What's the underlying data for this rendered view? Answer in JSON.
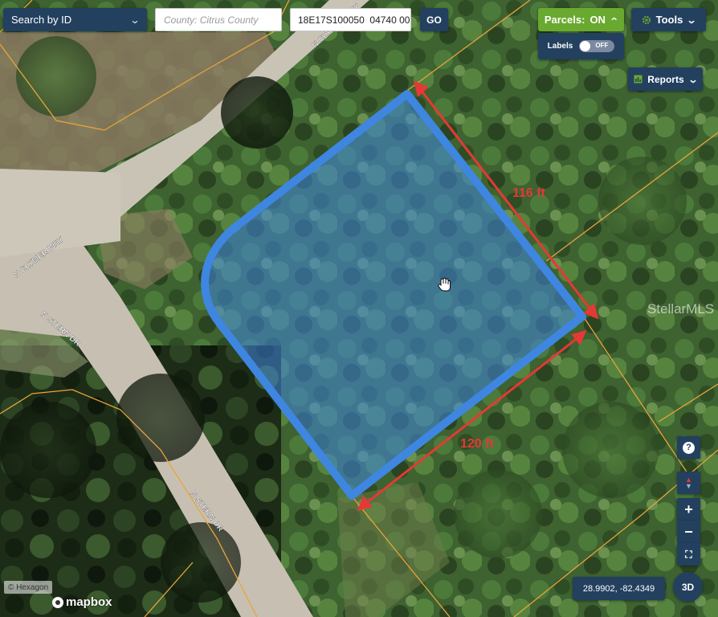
{
  "toolbar": {
    "search_mode": "Search by ID",
    "county_placeholder": "County: Citrus County",
    "parcel_id_value": "18E17S100050  04740 00",
    "go_label": "GO",
    "parcels_label": "Parcels:",
    "parcels_state": "ON",
    "labels_label": "Labels",
    "labels_state": "OFF",
    "tools_label": "Tools",
    "reports_label": "Reports"
  },
  "map": {
    "streets": [
      "N CLYMER WAY",
      "N CLYMER WAY",
      "N STERN DR",
      "N STERN DR"
    ],
    "dimensions": [
      "116 ft",
      "120 ft"
    ],
    "watermark": "StellarMLS",
    "parcel_color": "#3f86e0",
    "dimension_color": "#e53935",
    "parcel_line_color": "#e8a43a"
  },
  "controls": {
    "help_symbol": "?",
    "zoom_in_symbol": "+",
    "zoom_out_symbol": "−",
    "fullscreen_symbol": "⛶",
    "coordinates": "28.9902, -82.4349",
    "three_d_label": "3D",
    "icons": [
      "gear-icon",
      "report-icon",
      "help-icon",
      "compass-icon",
      "fullscreen-icon",
      "hand-cursor-icon"
    ]
  },
  "attribution": {
    "hexagon": "© Hexagon",
    "mapbox": "mapbox"
  }
}
